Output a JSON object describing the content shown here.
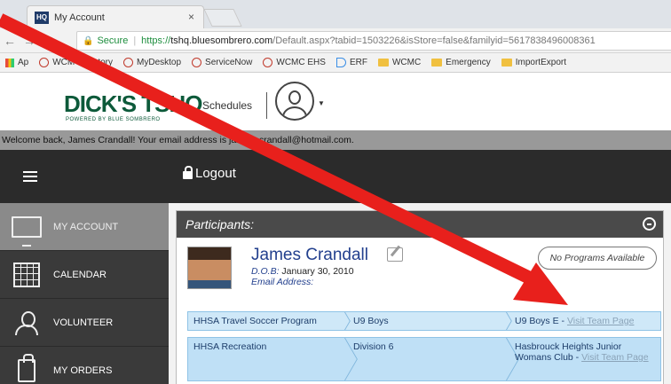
{
  "browser": {
    "tab_title": "My Account",
    "tab_close": "×",
    "favicon_text": "HQ",
    "secure_label": "Secure",
    "url_scheme": "https://",
    "url_host": "tshq.bluesombrero.com",
    "url_path": "/Default.aspx?tabid=1503226&isStore=false&familyid=5617838496008361",
    "bookmarks": [
      "Ap",
      "WCM Directory",
      "MyDesktop",
      "ServiceNow",
      "WCMC EHS",
      "ERF",
      "WCMC",
      "Emergency",
      "ImportExport"
    ]
  },
  "site": {
    "logo": "DICK'S TSHQ",
    "logo_sub": "POWERED BY BLUE SOMBRERO",
    "schedules_label": "Schedules",
    "welcome": "Welcome back, James Crandall! Your email address is james_crandall@hotmail.com.",
    "logout_label": "Logout"
  },
  "sidebar": {
    "items": [
      {
        "label": "MY ACCOUNT",
        "icon": "monitor-icon"
      },
      {
        "label": "CALENDAR",
        "icon": "calendar-icon"
      },
      {
        "label": "VOLUNTEER",
        "icon": "volunteer-icon"
      },
      {
        "label": "MY ORDERS",
        "icon": "shopping-bag-icon"
      }
    ]
  },
  "participants": {
    "heading": "Participants:",
    "name": "James Crandall",
    "dob_label": "D.O.B:",
    "dob": " January 30, 2010",
    "email_label": "Email Address:",
    "no_programs": "No Programs Available",
    "programs": [
      {
        "program": "HHSA Travel Soccer Program",
        "division": "U9 Boys",
        "team": "U9 Boys E",
        "link": "Visit Team Page"
      },
      {
        "program": "HHSA Recreation",
        "division": "Division 6",
        "team": "Hasbrouck Heights Junior Womans Club",
        "link": "Visit Team Page"
      }
    ]
  },
  "colors": {
    "annotation_arrow": "#e8201c",
    "sidebar_bg": "#3a3a3a",
    "active_item": "#8a8a8a",
    "program_row": "#cfe8f8"
  }
}
